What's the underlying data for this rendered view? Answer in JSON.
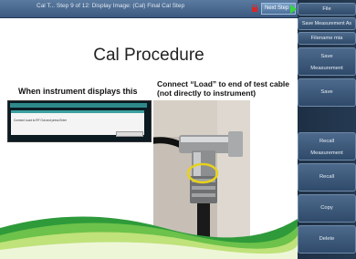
{
  "titlebar": {
    "title": "Cal T... Step 9 of 12: Display Image: (Cal) Final Cal Step",
    "next_step": "Next Step"
  },
  "slide": {
    "title": "Cal Procedure",
    "left_caption": "When instrument displays this",
    "right_caption": "Connect “Load” to end of test cable (not directly to instrument)",
    "instrument_prompt": "Connect Load to RF Out and press Enter"
  },
  "sidebar": {
    "file": "File",
    "save_measurement_as": "Save Measurement As",
    "filename_mia": "Filename mia",
    "save_measurement_line1": "Save",
    "save_measurement_line2": "Measurement",
    "save": "Save",
    "recall_measurement_line1": "Recall",
    "recall_measurement_line2": "Measurement",
    "recall": "Recall",
    "copy": "Copy",
    "delete": "Delete"
  },
  "colors": {
    "accent_green": "#37d63c",
    "lock_red": "#d62828",
    "sidebar_blue": "#2f4a6a"
  }
}
